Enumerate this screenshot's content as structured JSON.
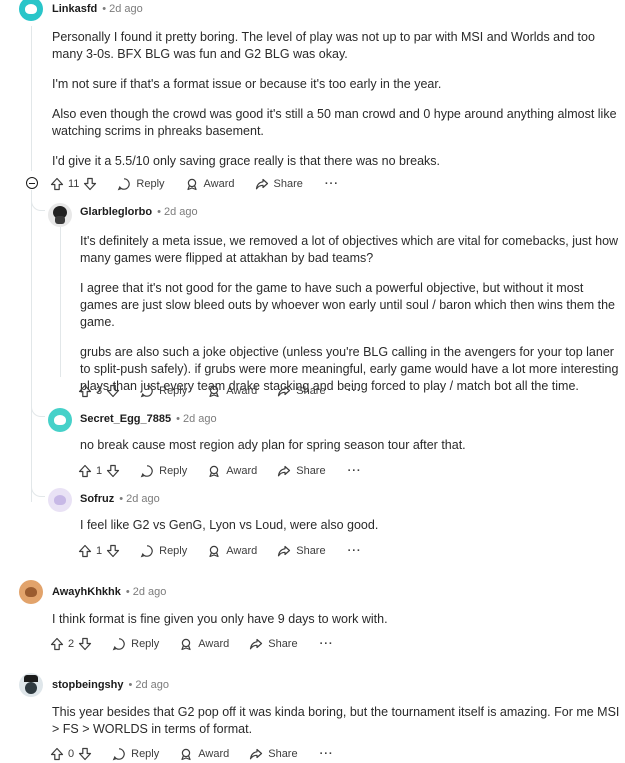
{
  "comments": [
    {
      "username": "Linkasfd",
      "time": "2d ago",
      "paragraphs": [
        "Personally I found it pretty boring. The level of play was not up to par with MSI and Worlds and too many 3-0s. BFX BLG was fun and G2 BLG was okay.",
        "I'm not sure if that's a format issue or because it's too early in the year.",
        "Also even though the crowd was good it's still a 50 man crowd and 0 hype around anything almost like watching scrims in phreaks basement.",
        "I'd give it a 5.5/10 only saving grace really is that there was no breaks."
      ],
      "votes": "11"
    },
    {
      "username": "Glarbleglorbo",
      "time": "2d ago",
      "paragraphs": [
        "It's definitely a meta issue, we removed a lot of objectives which are vital for comebacks, just how many games were flipped at attakhan by bad teams?",
        "I agree that it's not good for the game to have such a powerful objective, but without it most games are just slow bleed outs by whoever won early until soul / baron which then wins them the game.",
        "grubs are also such a joke objective (unless you're BLG calling in the avengers for your top laner to split-push safely). if grubs were more meaningful, early game would have a lot more interesting plays than just every team drake stacking and being forced to play / match bot all the time."
      ],
      "votes": "3"
    },
    {
      "username": "Secret_Egg_7885",
      "time": "2d ago",
      "paragraphs": [
        "no break cause most region ady plan for spring season tour after that."
      ],
      "votes": "1"
    },
    {
      "username": "Sofruz",
      "time": "2d ago",
      "paragraphs": [
        "I feel like G2 vs GenG, Lyon vs Loud, were also good."
      ],
      "votes": "1"
    },
    {
      "username": "AwayhKhkhk",
      "time": "2d ago",
      "paragraphs": [
        "I think format is fine given you only have 9 days to work with."
      ],
      "votes": "2"
    },
    {
      "username": "stopbeingshy",
      "time": "2d ago",
      "paragraphs": [
        "This year besides that G2 pop off it was kinda boring, but the tournament itself is amazing. For me MSI > FS > WORLDS in terms of format."
      ],
      "votes": "0"
    }
  ],
  "actions": {
    "reply": "Reply",
    "award": "Award",
    "share": "Share",
    "more": "···"
  },
  "dot": "•"
}
